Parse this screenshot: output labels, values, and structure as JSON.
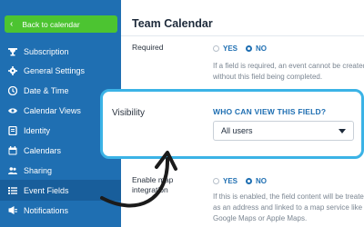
{
  "sidebar": {
    "back_label": "Back to calendar",
    "items": [
      {
        "label": "Subscription",
        "icon": "trophy-icon"
      },
      {
        "label": "General Settings",
        "icon": "gear-icon"
      },
      {
        "label": "Date & Time",
        "icon": "clock-icon"
      },
      {
        "label": "Calendar Views",
        "icon": "eye-icon"
      },
      {
        "label": "Identity",
        "icon": "id-icon"
      },
      {
        "label": "Calendars",
        "icon": "calendar-icon"
      },
      {
        "label": "Sharing",
        "icon": "users-icon"
      },
      {
        "label": "Event Fields",
        "icon": "list-icon"
      },
      {
        "label": "Notifications",
        "icon": "bell-icon"
      }
    ],
    "active_index": 7
  },
  "main": {
    "title": "Team Calendar",
    "required": {
      "label": "Required",
      "yes": "YES",
      "no": "NO",
      "selected": "NO",
      "help": "If a field is required, an event cannot be created without this field being completed."
    },
    "map": {
      "label_line1": "Enable map",
      "label_line2": "integration",
      "yes": "YES",
      "no": "NO",
      "selected": "NO",
      "help": "If this is enabled, the field content will be treated as an address and linked to a map service like Google Maps or Apple Maps."
    }
  },
  "popup": {
    "label": "Visibility",
    "question": "WHO CAN VIEW THIS FIELD?",
    "selected_value": "All users"
  },
  "colors": {
    "sidebar": "#1f6fb2",
    "back_button": "#4cc431",
    "popup_border": "#3bb3e6",
    "arrow": "#1b1b1b"
  }
}
